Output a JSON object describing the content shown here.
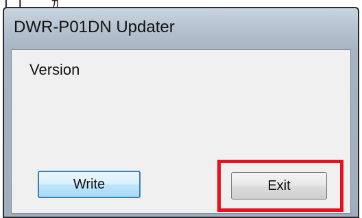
{
  "window": {
    "title": "DWR-P01DN Updater"
  },
  "main": {
    "version_label": "Version"
  },
  "buttons": {
    "write_label": "Write",
    "exit_label": "Exit"
  },
  "annotation": {
    "highlight_color": "#e8101c",
    "highlighted_element": "exit-button"
  }
}
